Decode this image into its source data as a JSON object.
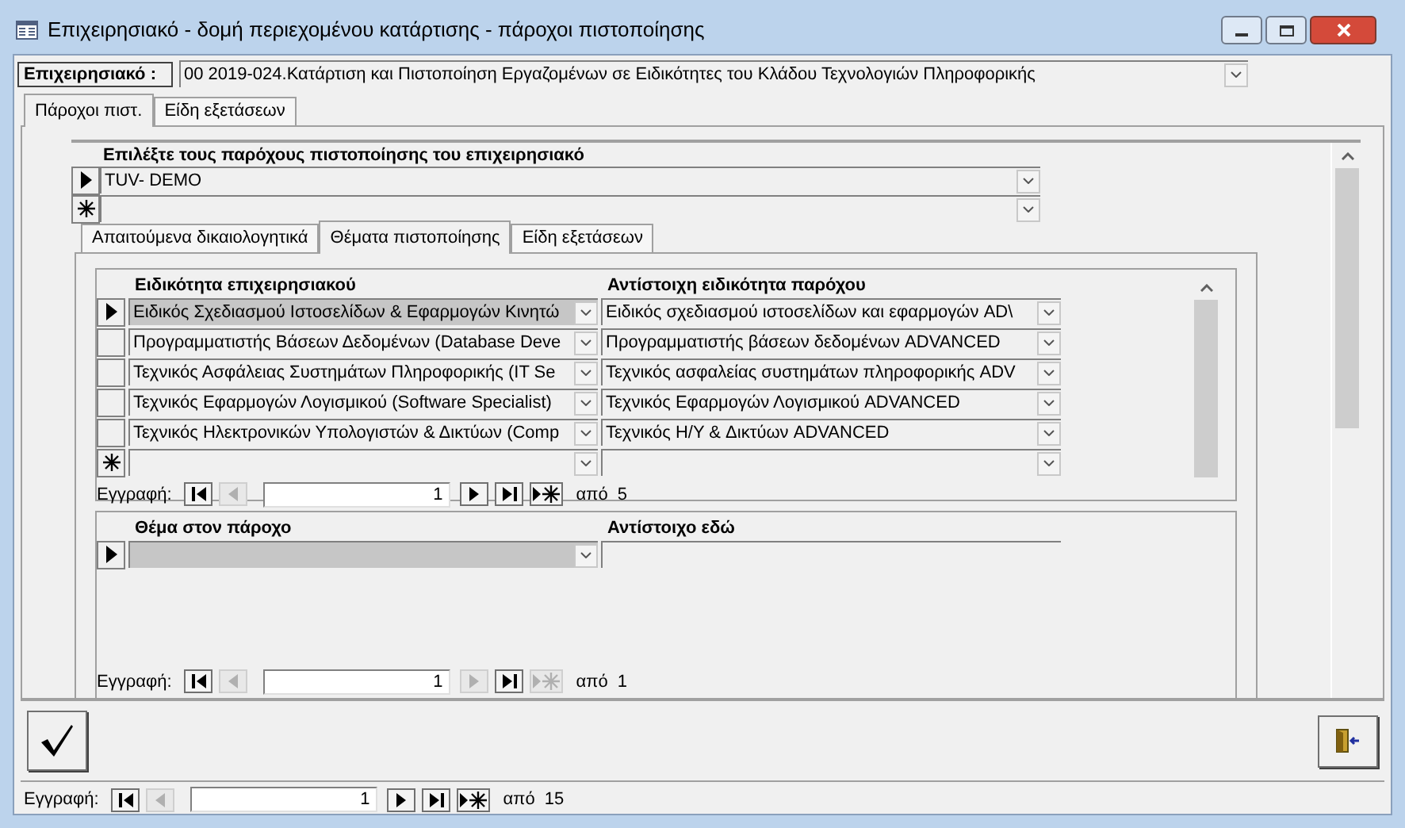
{
  "window": {
    "title": "Επιχειρησιακό - δομή περιεχομένου κατάρτισης - πάροχοι πιστοποίησης"
  },
  "header_field": {
    "label": "Επιχειρησιακό :",
    "value": "00 2019-024.Κατάρτιση και Πιστοποίηση Εργαζομένων σε Ειδικότητες του Κλάδου Τεχνολογιών Πληροφορικής"
  },
  "tabs": [
    {
      "label": "Πάροχοι πιστ.",
      "selected": true
    },
    {
      "label": "Είδη εξετάσεων",
      "selected": false
    }
  ],
  "providers": {
    "heading": "Επιλέξτε τους παρόχους πιστοποίησης του επιχειρησιακό",
    "rows": [
      {
        "kind": "current",
        "value": "TUV- DEMO"
      },
      {
        "kind": "new"
      }
    ]
  },
  "inner_tabs": [
    {
      "label": "Απαιτούμενα δικαιολογητικά",
      "selected": false
    },
    {
      "label": "Θέματα πιστοποίησης",
      "selected": true
    },
    {
      "label": "Είδη εξετάσεων",
      "selected": false
    }
  ],
  "specialties": {
    "columns": [
      {
        "label": "Ειδικότητα επιχειρησιακού",
        "kind": "combo"
      },
      {
        "label": "Αντίστοιχη ειδικότητα παρόχου",
        "kind": "combo"
      }
    ],
    "rows": [
      {
        "kind": "current",
        "focused": true,
        "values": [
          "Ειδικός Σχεδιασμού Ιστοσελίδων & Εφαρμογών Κινητώ",
          "Ειδικός σχεδιασμού ιστοσελίδων και εφαρμογών AD\\"
        ]
      },
      {
        "kind": "plain",
        "focused": false,
        "values": [
          "Προγραμματιστής Βάσεων Δεδομένων (Database Deve",
          "Προγραμματιστής βάσεων δεδομένων ADVANCED"
        ]
      },
      {
        "kind": "plain",
        "focused": false,
        "values": [
          "Τεχνικός Ασφάλειας Συστημάτων Πληροφορικής (IT Se",
          "Τεχνικός ασφαλείας συστημάτων πληροφορικής ADV"
        ]
      },
      {
        "kind": "plain",
        "focused": false,
        "values": [
          "Τεχνικός Εφαρμογών Λογισμικού (Software Specialist)",
          "Τεχνικός Εφαρμογών Λογισμικού ADVANCED"
        ]
      },
      {
        "kind": "plain",
        "focused": false,
        "values": [
          "Τεχνικός Ηλεκτρονικών Υπολογιστών & Δικτύων (Comp",
          "Τεχνικός H/Y & Δικτύων ADVANCED"
        ]
      },
      {
        "kind": "new",
        "focused": false
      }
    ],
    "navigation": {
      "label": "Εγγραφή:",
      "record": "1",
      "of": "από",
      "total": "5",
      "buttons": [
        {
          "kind": "first",
          "disabled": false
        },
        {
          "kind": "previous",
          "disabled": true
        },
        {
          "kind": "next",
          "disabled": false
        },
        {
          "kind": "last",
          "disabled": false
        },
        {
          "kind": "new",
          "disabled": false
        }
      ]
    }
  },
  "topics": {
    "columns": [
      {
        "label": "Θέμα στον πάροχο",
        "kind": "combo"
      },
      {
        "label": "Αντίστοιχο εδώ",
        "kind": "text"
      }
    ],
    "rows": [
      {
        "kind": "current",
        "focused": true
      }
    ],
    "navigation": {
      "label": "Εγγραφή:",
      "record": "1",
      "of": "από",
      "total": "1",
      "buttons": [
        {
          "kind": "first",
          "disabled": false
        },
        {
          "kind": "previous",
          "disabled": true
        },
        {
          "kind": "next",
          "disabled": true
        },
        {
          "kind": "last",
          "disabled": false
        },
        {
          "kind": "new",
          "disabled": true
        }
      ]
    }
  },
  "navigation": {
    "label": "Εγγραφή:",
    "record": "1",
    "of": "από",
    "total": "15",
    "buttons": [
      {
        "kind": "first",
        "disabled": false
      },
      {
        "kind": "previous",
        "disabled": true
      },
      {
        "kind": "next",
        "disabled": false
      },
      {
        "kind": "last",
        "disabled": false
      },
      {
        "kind": "new",
        "disabled": false
      }
    ]
  }
}
